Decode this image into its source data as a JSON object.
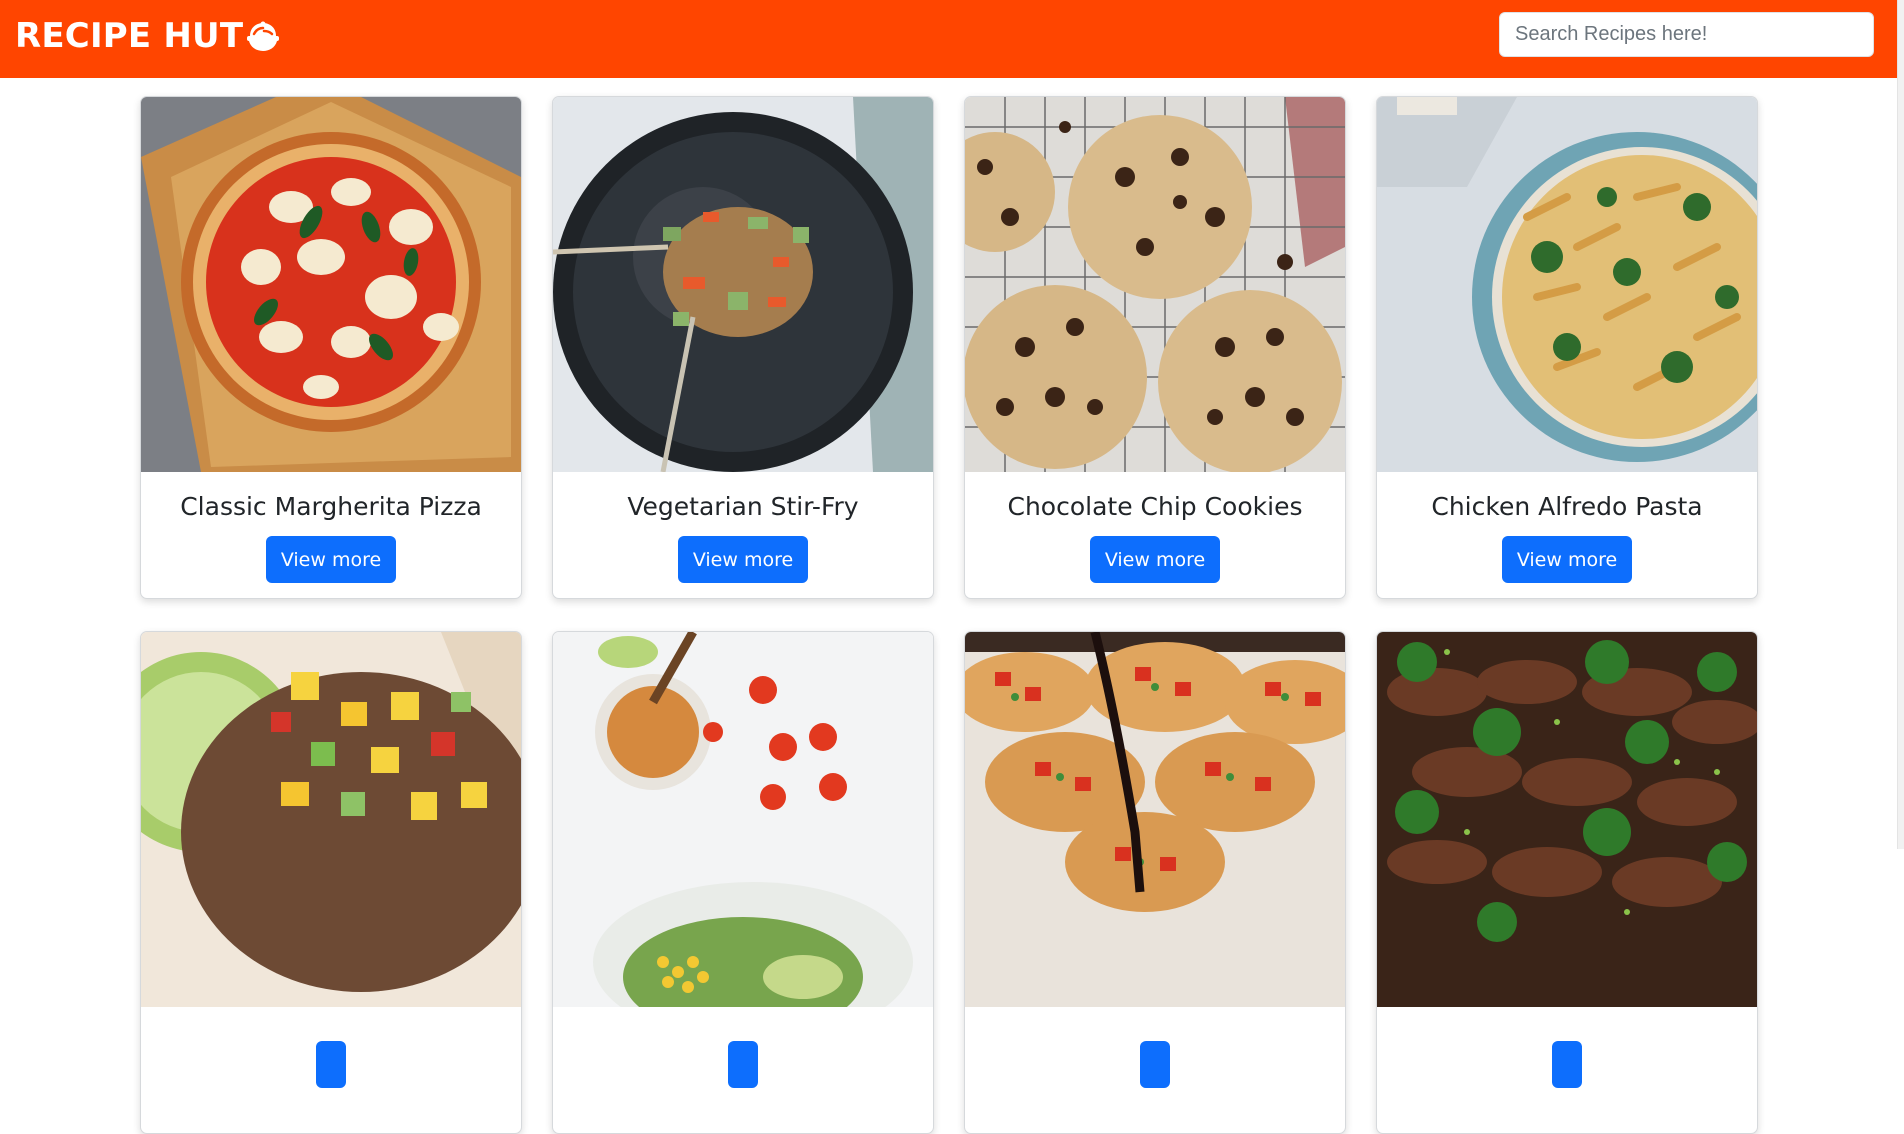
{
  "navbar": {
    "brand": "RECIPE HUT",
    "brand_icon": "bowl-icon",
    "background_color": "#ff4500",
    "search_placeholder": "Search Recipes here!",
    "search_value": ""
  },
  "button_color": "#0d6efd",
  "recipes": [
    {
      "title": "Classic Margherita Pizza",
      "button_label": "View more",
      "image": "pizza-photo"
    },
    {
      "title": "Vegetarian Stir-Fry",
      "button_label": "View more",
      "image": "stir-fry-photo"
    },
    {
      "title": "Chocolate Chip Cookies",
      "button_label": "View more",
      "image": "cookies-photo"
    },
    {
      "title": "Chicken Alfredo Pasta",
      "button_label": "View more",
      "image": "pasta-photo"
    },
    {
      "title": "",
      "button_label": "",
      "image": "mango-salsa-photo"
    },
    {
      "title": "",
      "button_label": "",
      "image": "salad-dressing-photo"
    },
    {
      "title": "",
      "button_label": "",
      "image": "bruschetta-photo"
    },
    {
      "title": "",
      "button_label": "",
      "image": "beef-broccoli-photo"
    }
  ]
}
